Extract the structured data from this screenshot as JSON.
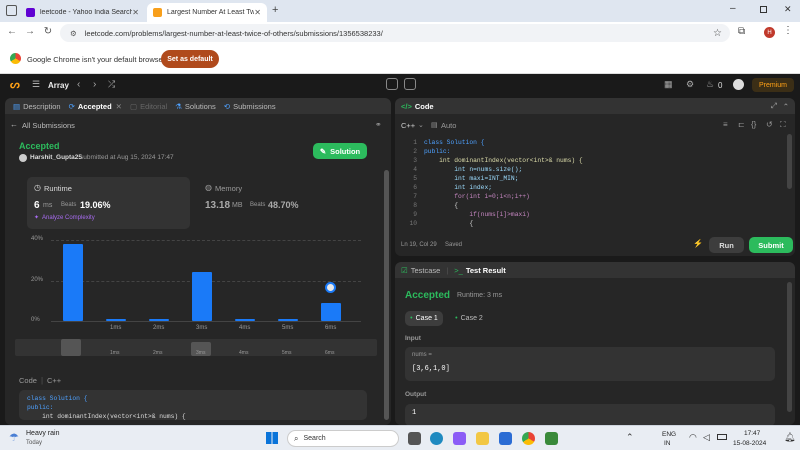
{
  "browser": {
    "tabs": [
      {
        "label": "leetcode - Yahoo India Search R",
        "active": false
      },
      {
        "label": "Largest Number At Least Twice",
        "active": true
      }
    ],
    "url": "leetcode.com/problems/largest-number-at-least-twice-of-others/submissions/1356538233/",
    "default_msg": "Google Chrome isn't your default browser",
    "set_default_label": "Set as default",
    "profile_initial": "H"
  },
  "lcnav": {
    "problem_list": "Array",
    "notifications_count": "0",
    "premium_label": "Premium"
  },
  "left": {
    "tabs": {
      "description": "Description",
      "accepted": "Accepted",
      "editorial": "Editorial",
      "solutions": "Solutions",
      "submissions": "Submissions"
    },
    "all_submissions": "All Submissions",
    "status": "Accepted",
    "user": "Harshit_Gupta25",
    "submitted_at": "submitted at Aug 15, 2024 17:47",
    "solution_btn": "Solution",
    "runtime_label": "Runtime",
    "runtime_value": "6",
    "runtime_unit": "ms",
    "beats_label": "Beats",
    "runtime_beats": "19.06%",
    "analyze": "Analyze Complexity",
    "memory_label": "Memory",
    "memory_value": "13.18",
    "memory_unit": "MB",
    "memory_beats": "48.70%",
    "code_label": "Code",
    "code_lang": "C++",
    "code_preview": [
      "class Solution {",
      "public:",
      "    int dominantIndex(vector<int>& nums) {"
    ]
  },
  "chart_data": {
    "type": "bar",
    "categories": [
      "",
      "1ms",
      "2ms",
      "3ms",
      "4ms",
      "5ms",
      "6ms"
    ],
    "values": [
      38,
      1,
      1,
      24,
      1,
      1,
      9
    ],
    "ylim": [
      0,
      40
    ],
    "yticks": [
      "40%",
      "20%",
      "0%"
    ],
    "highlight_index": 6,
    "range_labels": [
      "1ms",
      "2ms",
      "3ms",
      "4ms",
      "5ms",
      "6ms"
    ]
  },
  "editor": {
    "title": "Code",
    "lang": "C++",
    "auto": "Auto",
    "line_numbers": [
      "1",
      "2",
      "3",
      "4",
      "5",
      "6",
      "7",
      "8",
      "9",
      "10"
    ],
    "lines": [
      "class Solution {",
      "public:",
      "    int dominantIndex(vector<int>& nums) {",
      "        int n=nums.size();",
      "        int maxi=INT_MIN;",
      "        int index;",
      "        for(int i=0;i<n;i++)",
      "        {",
      "            if(nums[i]>maxi)",
      "            {"
    ],
    "cursor_pos": "Ln 19, Col 29",
    "saved": "Saved",
    "run": "Run",
    "submit": "Submit"
  },
  "result": {
    "testcase_tab": "Testcase",
    "result_tab": "Test Result",
    "status": "Accepted",
    "runtime": "Runtime: 3 ms",
    "case1": "Case 1",
    "case2": "Case 2",
    "input_label": "Input",
    "var_name": "nums =",
    "var_value": "[3,6,1,0]",
    "output_label": "Output",
    "output_value": "1"
  },
  "taskbar": {
    "weather": "Heavy rain",
    "weather_sub": "Today",
    "search": "Search",
    "lang": "ENG",
    "region": "IN",
    "time": "17:47",
    "date": "15-08-2024"
  }
}
